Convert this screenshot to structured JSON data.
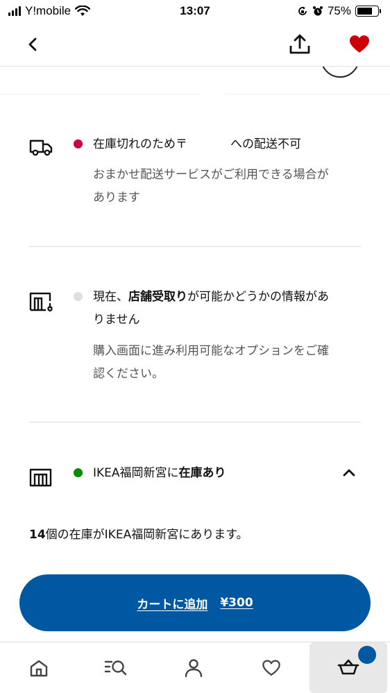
{
  "status_bar": {
    "carrier": "Y!mobile",
    "time": "13:07",
    "battery": "75%",
    "battery_level": 0.75
  },
  "nav": {
    "back_icon": "chevron-left-icon",
    "share_icon": "share-icon",
    "favorite_icon": "heart-filled-icon"
  },
  "colors": {
    "accent": "#0058a3",
    "heart": "#cc0008",
    "unavailable": "#cc0044",
    "unknown": "#dfdfdf",
    "available": "#0a8a00"
  },
  "delivery": {
    "text_pre": "在庫切れのため〒",
    "text_post": "への配送不可",
    "sub": "おまかせ配送サービスがご利用できる場合があります"
  },
  "pickup": {
    "text_pre": "現在、",
    "text_bold": "店舗受取り",
    "text_post": "が可能かどうかの情報がありません",
    "sub": "購入画面に進み利用可能なオプションをご確認ください。"
  },
  "store": {
    "text_pre": "IKEA福岡新宮に",
    "text_bold": "在庫あり",
    "toggle_icon": "chevron-up-icon"
  },
  "stock_note": {
    "count": "14",
    "text": "個の在庫がIKEA福岡新宮にあります。"
  },
  "cart_button": {
    "label": "カートに追加",
    "price": "¥300"
  },
  "tabs": [
    {
      "icon": "home-icon"
    },
    {
      "icon": "search-list-icon"
    },
    {
      "icon": "profile-icon"
    },
    {
      "icon": "heart-outline-icon"
    },
    {
      "icon": "cart-icon"
    }
  ]
}
